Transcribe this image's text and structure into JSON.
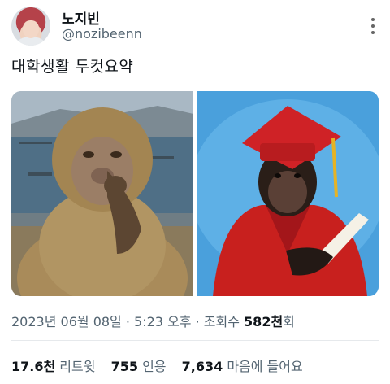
{
  "user": {
    "display_name": "노지빈",
    "handle": "@nozibeenn"
  },
  "tweet": {
    "text": "대학생활 두컷요약"
  },
  "meta": {
    "date": "2023년 06월 08일",
    "time": "5:23 오후",
    "views_label": "조회수",
    "views_count": "582천",
    "views_suffix": "회"
  },
  "stats": {
    "retweets_count": "17.6천",
    "retweets_label": "리트윗",
    "quotes_count": "755",
    "quotes_label": "인용",
    "likes_count": "7,634",
    "likes_label": "마음에 들어요"
  },
  "colors": {
    "secondary_text": "#536471",
    "primary_text": "#0f1419",
    "sky_blue": "#4aa0dc",
    "graduation_red": "#c8201e"
  },
  "icons": [
    "more-options-icon"
  ]
}
